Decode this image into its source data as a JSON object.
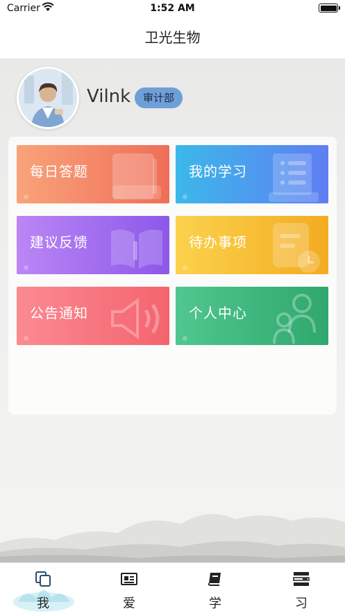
{
  "status_bar": {
    "carrier": "Carrier",
    "time": "1:52 AM"
  },
  "nav": {
    "title": "卫光生物"
  },
  "profile": {
    "username": "Vilnk",
    "department": "审计部"
  },
  "tiles": [
    {
      "label": "每日答题",
      "icon": "book-icon"
    },
    {
      "label": "我的学习",
      "icon": "scroll-list-icon"
    },
    {
      "label": "建议反馈",
      "icon": "open-book-icon"
    },
    {
      "label": "待办事项",
      "icon": "note-clock-icon"
    },
    {
      "label": "公告通知",
      "icon": "speaker-icon"
    },
    {
      "label": "个人中心",
      "icon": "people-icon"
    }
  ],
  "tab_bar": {
    "items": [
      {
        "label": "我",
        "icon": "copy-icon",
        "active": true
      },
      {
        "label": "爱",
        "icon": "newspaper-icon",
        "active": false
      },
      {
        "label": "学",
        "icon": "book-icon",
        "active": false
      },
      {
        "label": "习",
        "icon": "list-icon",
        "active": false
      }
    ]
  },
  "colors": {
    "accent_badge": "#6f9fd8",
    "tab_active_glow": "#bfe7f0"
  }
}
